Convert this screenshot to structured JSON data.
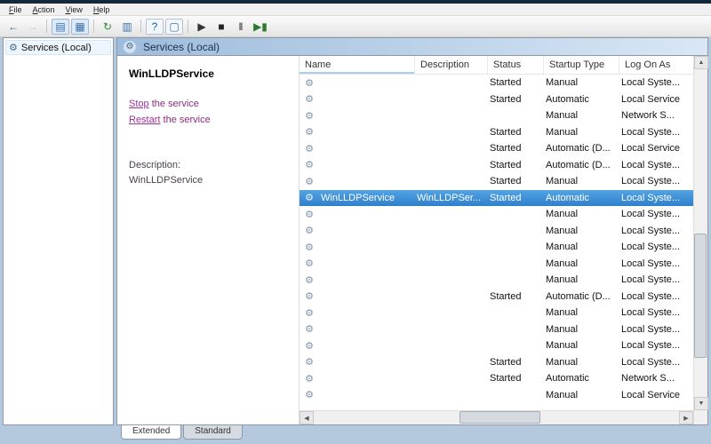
{
  "colors": {
    "selection_blue": "#3c95dd",
    "link_purple": "#993399",
    "pane_header_gradient_start": "#9dbcdb",
    "pane_header_gradient_end": "#d9e7f5"
  },
  "menu": {
    "items": [
      "File",
      "Action",
      "View",
      "Help"
    ]
  },
  "toolbar": {
    "buttons": [
      {
        "name": "back",
        "icon": "left-arrow-icon",
        "glyph": "←",
        "color": "#1b5fae"
      },
      {
        "name": "forward",
        "icon": "right-arrow-icon",
        "glyph": "→",
        "color": "#8f9aa5",
        "state": "disabled"
      },
      {
        "type": "sep"
      },
      {
        "name": "show-console-tree",
        "icon": "console-tree-icon",
        "glyph": "▤",
        "color": "#3a6ea5",
        "state": "toggled"
      },
      {
        "name": "properties",
        "icon": "properties-icon",
        "glyph": "▦",
        "color": "#3a6ea5",
        "state": "toggled"
      },
      {
        "type": "sep"
      },
      {
        "name": "refresh",
        "icon": "refresh-icon",
        "glyph": "↻",
        "color": "#2c8a2c"
      },
      {
        "name": "export-list",
        "icon": "export-list-icon",
        "glyph": "▥",
        "color": "#3a6ea5"
      },
      {
        "type": "sep"
      },
      {
        "name": "help",
        "icon": "help-icon",
        "glyph": "?",
        "color": "#1b5fae",
        "state": "boxed"
      },
      {
        "name": "window",
        "icon": "window-icon",
        "glyph": "▢",
        "color": "#3a6ea5",
        "state": "boxed"
      },
      {
        "type": "sep"
      },
      {
        "name": "start-service",
        "icon": "play-icon",
        "glyph": "▶",
        "color": "#333333"
      },
      {
        "name": "stop-service",
        "icon": "stop-icon",
        "glyph": "■",
        "color": "#222222"
      },
      {
        "name": "pause-service",
        "icon": "pause-icon",
        "glyph": "‖",
        "color": "#222222"
      },
      {
        "name": "restart-service",
        "icon": "restart-icon",
        "glyph": "▶▮",
        "color": "#2c7a2c"
      }
    ]
  },
  "tree": {
    "root_label": "Services (Local)"
  },
  "pane_header": {
    "title": "Services (Local)"
  },
  "extended_panel": {
    "service_name": "WinLLDPService",
    "stop_link": "Stop",
    "stop_suffix": " the service",
    "restart_link": "Restart",
    "restart_suffix": " the service",
    "description_label": "Description:",
    "description_text": "WinLLDPService"
  },
  "table": {
    "columns": [
      "Name",
      "Description",
      "Status",
      "Startup Type",
      "Log On As"
    ],
    "rows": [
      {
        "name": "",
        "description": "",
        "status": "Started",
        "startup": "Manual",
        "logon": "Local Syste...",
        "selected": false
      },
      {
        "name": "",
        "description": "",
        "status": "Started",
        "startup": "Automatic",
        "logon": "Local Service",
        "selected": false
      },
      {
        "name": "",
        "description": "",
        "status": "",
        "startup": "Manual",
        "logon": "Network S...",
        "selected": false
      },
      {
        "name": "",
        "description": "",
        "status": "Started",
        "startup": "Manual",
        "logon": "Local Syste...",
        "selected": false
      },
      {
        "name": "",
        "description": "",
        "status": "Started",
        "startup": "Automatic (D...",
        "logon": "Local Service",
        "selected": false
      },
      {
        "name": "",
        "description": "",
        "status": "Started",
        "startup": "Automatic (D...",
        "logon": "Local Syste...",
        "selected": false
      },
      {
        "name": "",
        "description": "",
        "status": "Started",
        "startup": "Manual",
        "logon": "Local Syste...",
        "selected": false
      },
      {
        "name": "WinLLDPService",
        "description": "WinLLDPSer...",
        "status": "Started",
        "startup": "Automatic",
        "logon": "Local Syste...",
        "selected": true
      },
      {
        "name": "",
        "description": "",
        "status": "",
        "startup": "Manual",
        "logon": "Local Syste...",
        "selected": false
      },
      {
        "name": "",
        "description": "",
        "status": "",
        "startup": "Manual",
        "logon": "Local Syste...",
        "selected": false
      },
      {
        "name": "",
        "description": "",
        "status": "",
        "startup": "Manual",
        "logon": "Local Syste...",
        "selected": false
      },
      {
        "name": "",
        "description": "",
        "status": "",
        "startup": "Manual",
        "logon": "Local Syste...",
        "selected": false
      },
      {
        "name": "",
        "description": "",
        "status": "",
        "startup": "Manual",
        "logon": "Local Syste...",
        "selected": false
      },
      {
        "name": "",
        "description": "",
        "status": "Started",
        "startup": "Automatic (D...",
        "logon": "Local Syste...",
        "selected": false
      },
      {
        "name": "",
        "description": "",
        "status": "",
        "startup": "Manual",
        "logon": "Local Syste...",
        "selected": false
      },
      {
        "name": "",
        "description": "",
        "status": "",
        "startup": "Manual",
        "logon": "Local Syste...",
        "selected": false
      },
      {
        "name": "",
        "description": "",
        "status": "",
        "startup": "Manual",
        "logon": "Local Syste...",
        "selected": false
      },
      {
        "name": "",
        "description": "",
        "status": "Started",
        "startup": "Manual",
        "logon": "Local Syste...",
        "selected": false
      },
      {
        "name": "",
        "description": "",
        "status": "Started",
        "startup": "Automatic",
        "logon": "Network S...",
        "selected": false
      },
      {
        "name": "",
        "description": "",
        "status": "",
        "startup": "Manual",
        "logon": "Local Service",
        "selected": false
      }
    ]
  },
  "tabs": {
    "extended": "Extended",
    "standard": "Standard"
  }
}
